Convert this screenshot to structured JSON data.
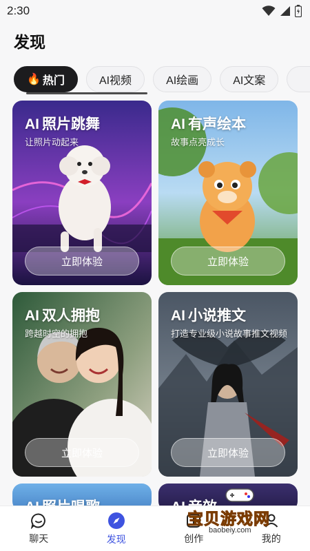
{
  "status_bar": {
    "time": "2:30"
  },
  "page_title": "发现",
  "tabs": [
    {
      "label": "热门",
      "emoji": "🔥",
      "active": true
    },
    {
      "label": "AI视频"
    },
    {
      "label": "AI绘画"
    },
    {
      "label": "AI文案"
    }
  ],
  "cards": [
    {
      "title_ai": "AI",
      "title": "照片跳舞",
      "subtitle": "让照片动起来",
      "button": "立即体验"
    },
    {
      "title_ai": "AI",
      "title": "有声绘本",
      "subtitle": "故事点亮成长",
      "button": "立即体验"
    },
    {
      "title_ai": "AI",
      "title": "双人拥抱",
      "subtitle": "跨越时空的拥抱",
      "button": "立即体验"
    },
    {
      "title_ai": "AI",
      "title": "小说推文",
      "subtitle": "打造专业级小说故事推文视频",
      "button": "立即体验"
    },
    {
      "title_ai": "AI",
      "title": "照片唱歌"
    },
    {
      "title_ai": "AI",
      "title": "音效"
    }
  ],
  "bottom_nav": [
    {
      "label": "聊天",
      "icon": "chat-icon"
    },
    {
      "label": "发现",
      "icon": "compass-icon",
      "active": true
    },
    {
      "label": "创作",
      "icon": "create-icon"
    },
    {
      "label": "我的",
      "icon": "profile-icon"
    }
  ],
  "watermark": {
    "text": "宝贝游戏网",
    "url": "baobeiy.com"
  },
  "colors": {
    "accent": "#3e53e0",
    "tab_active": "#1c1c1e"
  }
}
